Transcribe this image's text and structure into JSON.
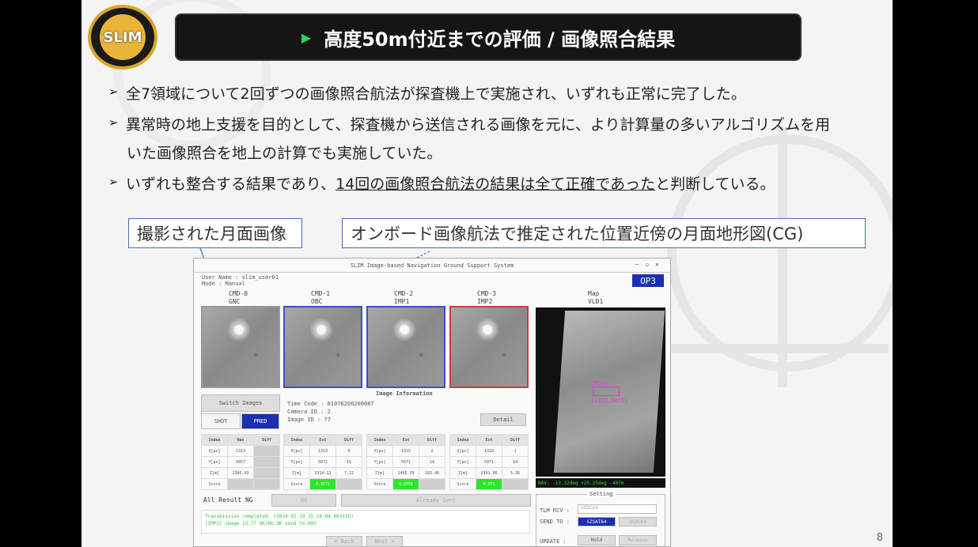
{
  "title": "高度50m付近までの評価 / 画像照合結果",
  "logo_text": "SLIM",
  "bullets": [
    "全7領域について2回ずつの画像照合航法が探査機上で実施され、いずれも正常に完了した。",
    "異常時の地上支援を目的として、探査機から送信される画像を元に、より計算量の多いアルゴリズムを用",
    "いた画像照合を地上の計算でも実施していた。",
    "いずれも整合する結果であり、",
    "14回の画像照合航法の結果は全て正確であった",
    "と判断している。"
  ],
  "callouts": {
    "left": "撮影された月面画像",
    "right": "オンボード画像航法で推定された位置近傍の月面地形図(CG)"
  },
  "window": {
    "title": "SLIM Image-based Navigation Ground Support System",
    "user": "User Name : slim_user01",
    "mode": "Mode : Manual",
    "op_badge": "OP3",
    "cameras": [
      {
        "cmd": "CMD-0",
        "sub": "GNC"
      },
      {
        "cmd": "CMD-1",
        "sub": "OBC"
      },
      {
        "cmd": "CMD-2",
        "sub": "IMP1"
      },
      {
        "cmd": "CMD-3",
        "sub": "IMP2"
      }
    ],
    "map_header": {
      "cmd": "Map",
      "sub": "VLD1"
    },
    "switch_images": "Switch Images",
    "shot": "SHOT",
    "pred": "PRED",
    "image_info": {
      "header": "Image Information",
      "time_code": "Time Code    :  01076206200087",
      "camera_id": "Camera ID    :  2",
      "image_id": "Image ID     :  77",
      "detail": "Detail"
    },
    "tables": [
      {
        "h": [
          "Index",
          "Nav",
          "Diff"
        ],
        "rows": [
          [
            "X[px]",
            "1313",
            ""
          ],
          [
            "Y[px]",
            "5057",
            ""
          ],
          [
            "Z[m]",
            "2306.93",
            ""
          ],
          [
            "Score",
            "",
            ""
          ]
        ]
      },
      {
        "h": [
          "Index",
          "Est",
          "Diff"
        ],
        "rows": [
          [
            "X[px]",
            "1313",
            "0"
          ],
          [
            "Y[px]",
            "5072",
            "15"
          ],
          [
            "Z[m]",
            "2314.13",
            "7.22"
          ],
          [
            "Score",
            "0.4771",
            ""
          ]
        ]
      },
      {
        "h": [
          "Index",
          "Est",
          "Diff"
        ],
        "rows": [
          [
            "X[px]",
            "1315",
            "2"
          ],
          [
            "Y[px]",
            "5071",
            "14"
          ],
          [
            "Z[m]",
            "2405.39",
            "103.46"
          ],
          [
            "Score",
            "0.9751",
            ""
          ]
        ]
      },
      {
        "h": [
          "Index",
          "Est",
          "Diff"
        ],
        "rows": [
          [
            "X[px]",
            "1314",
            "1"
          ],
          [
            "Y[px]",
            "5071",
            "14"
          ],
          [
            "Z[m]",
            "2301.96",
            "5.36"
          ],
          [
            "Score",
            "0.973",
            ""
          ]
        ]
      }
    ],
    "all_result": "All Result NG",
    "ng": "NG",
    "already_sent": "Already Sent",
    "log1": "Transmission completed. (2024-01-19 15:16:04.003156)",
    "log2": "[IMP2] image id:77 OK/NG:OK send to:005",
    "back": "< Back",
    "next": "Next >",
    "map_box_top": "CMD-2",
    "map_box_bottom": "[1318,5071]",
    "nav_status": "NAV: -13.32deg +25.25deg  -407m",
    "setting": {
      "header": "Setting",
      "tlm_label": "TLM RCV :",
      "tlm_value": "USDC64",
      "send_label": "SEND TO :",
      "send_value": "SZSAT64",
      "send_value2": "USDC64",
      "update_label": "UPDATE  :",
      "hold": "Hold",
      "release": "Release"
    }
  },
  "page_number": "8"
}
